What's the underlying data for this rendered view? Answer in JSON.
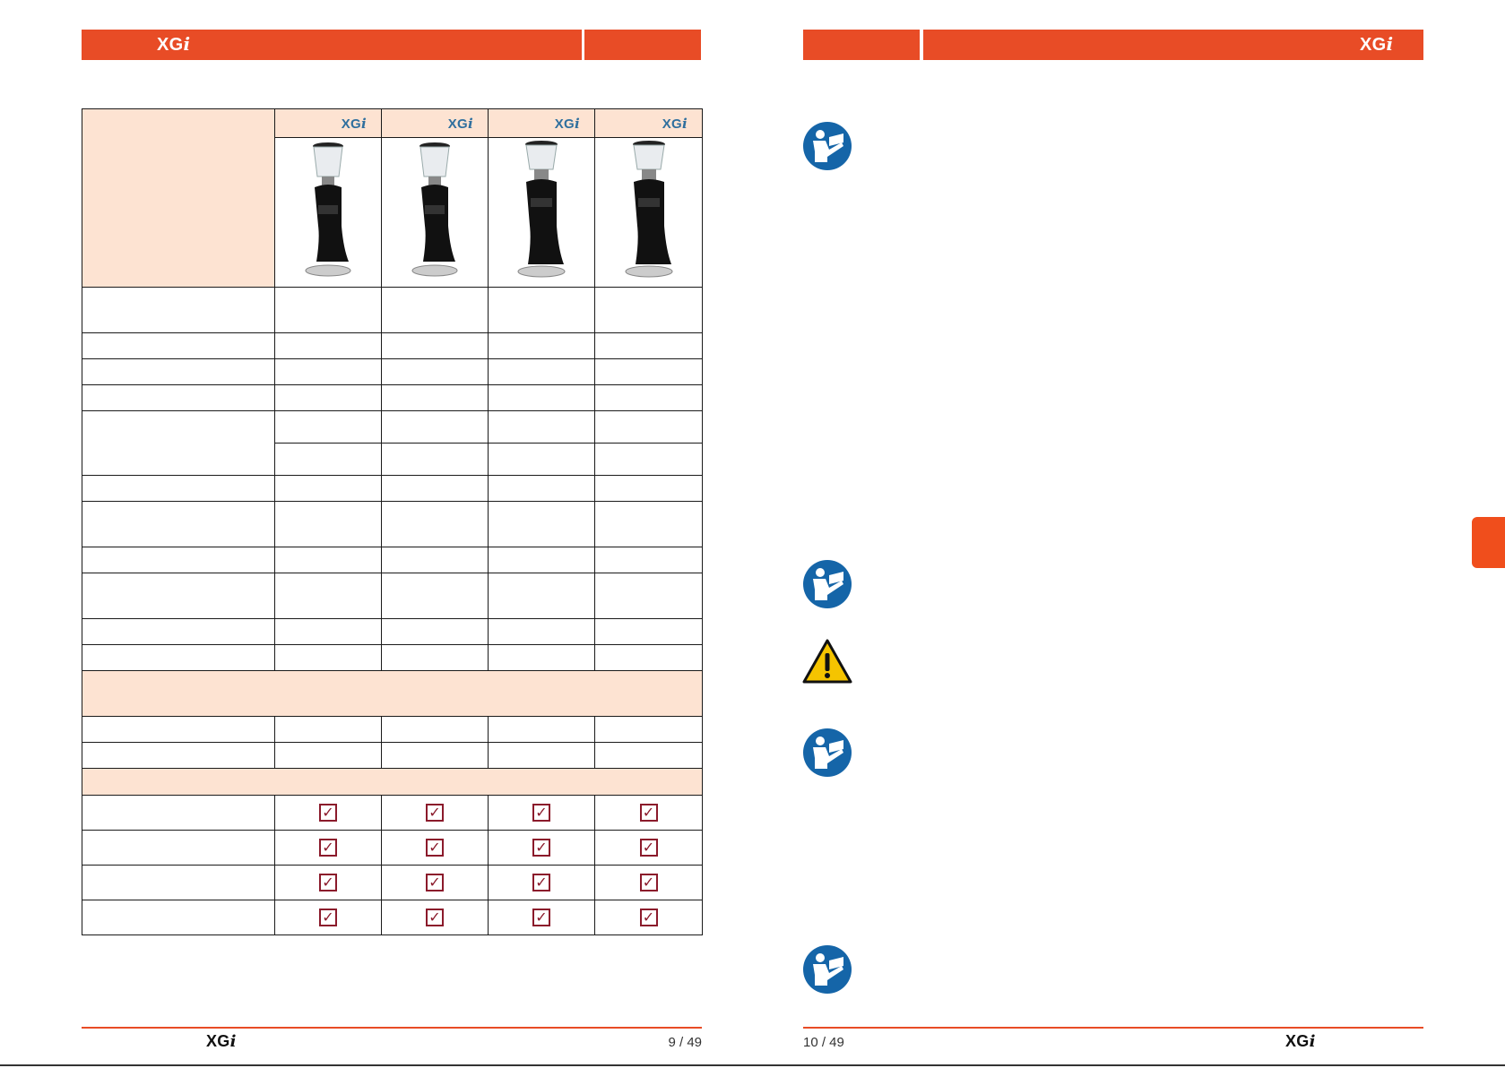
{
  "brand": {
    "logo_main": "XG",
    "logo_i": "i"
  },
  "colors": {
    "accent": "#e84c26",
    "peach": "#fde3d2",
    "check": "#8b1a2b",
    "info_icon": "#1565a8",
    "warning_icon": "#f5c400"
  },
  "left_page": {
    "page_number": "9 / 49",
    "table": {
      "model_count": 4,
      "icons": {
        "image": "coffee-grinder-image",
        "check": "check-icon"
      }
    }
  },
  "right_page": {
    "page_number": "10 / 49",
    "icons": [
      "manual-info-icon",
      "manual-info-icon",
      "warning-triangle-icon",
      "manual-info-icon",
      "manual-info-icon"
    ]
  }
}
